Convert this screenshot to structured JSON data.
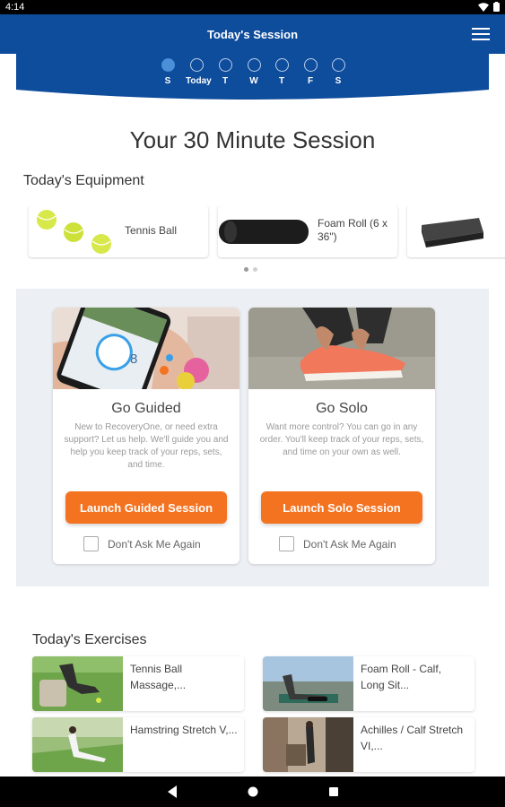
{
  "status_bar": {
    "time": "4:14"
  },
  "app_bar": {
    "title": "Today's Session"
  },
  "days": [
    {
      "label": "S",
      "filled": true
    },
    {
      "label": "Today",
      "filled": false
    },
    {
      "label": "T",
      "filled": false
    },
    {
      "label": "W",
      "filled": false
    },
    {
      "label": "T",
      "filled": false
    },
    {
      "label": "F",
      "filled": false
    },
    {
      "label": "S",
      "filled": false
    }
  ],
  "headline": "Your 30 Minute Session",
  "equipment": {
    "title": "Today's Equipment",
    "items": [
      {
        "name": "Tennis Ball"
      },
      {
        "name": "Foam Roll (6 x 36\")"
      }
    ]
  },
  "modes": {
    "guided": {
      "title": "Go Guided",
      "description": "New to RecoveryOne, or need extra support? Let us help. We'll guide you and help you keep track of your reps, sets, and time.",
      "button": "Launch Guided Session",
      "checkbox": "Don't Ask Me Again",
      "photo_number": "8"
    },
    "solo": {
      "title": "Go Solo",
      "description": "Want more control? You can go in any order. You'll keep track of your reps, sets, and time on your own as well.",
      "button": "Launch Solo Session",
      "checkbox": "Don't Ask Me Again"
    }
  },
  "exercises": {
    "title": "Today's Exercises",
    "items": [
      {
        "name": "Tennis Ball Massage,..."
      },
      {
        "name": "Foam Roll - Calf, Long Sit..."
      },
      {
        "name": "Hamstring Stretch V,..."
      },
      {
        "name": "Achilles / Calf Stretch VI,..."
      }
    ]
  },
  "colors": {
    "primary": "#0e4c9c",
    "accent": "#f47321",
    "panel": "#eceff3"
  }
}
